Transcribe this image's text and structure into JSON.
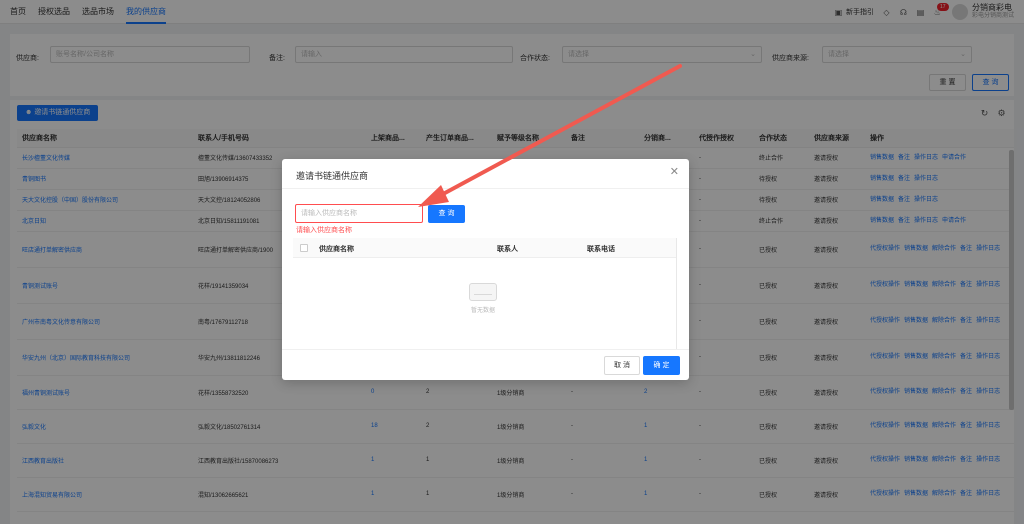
{
  "nav": {
    "tabs": [
      {
        "label": "首页"
      },
      {
        "label": "授权选品"
      },
      {
        "label": "选品市场"
      },
      {
        "label": "我的供应商",
        "active": true
      }
    ],
    "guide_label": "新手指引",
    "notification_count": "17",
    "user_name": "分销商彩电",
    "user_sub": "彩电分销商测试"
  },
  "filter": {
    "supplier_label": "供应商:",
    "supplier_placeholder": "账号名称/公司名称",
    "remark_label": "备注:",
    "remark_placeholder": "请输入",
    "coop_label": "合作状态:",
    "coop_placeholder": "请选择",
    "source_label": "供应商来源:",
    "source_placeholder": "请选择",
    "reset_label": "重 置",
    "search_label": "查 询"
  },
  "toolbar": {
    "invite_label": "邀请书链通供应商"
  },
  "table": {
    "columns": [
      "供应商名称",
      "联系人/手机号码",
      "上架商品...",
      "产生订单商品...",
      "赋予等级名称",
      "备注",
      "分销商...",
      "代授作授权",
      "合作状态",
      "供应商来源",
      "操作"
    ],
    "rows": [
      {
        "name": "长沙檀董文化传媒",
        "contact": "檀董文化传媒/13607433352",
        "c3": "",
        "c4": "",
        "c5": "",
        "c6": "",
        "c7": "",
        "c8": "-",
        "status": "终止合作",
        "source": "邀请授权",
        "ops": [
          "销售数据",
          "备注",
          "操作日志",
          "申请合作"
        ]
      },
      {
        "name": "青铜图书",
        "contact": "田旭/13906914375",
        "c3": "",
        "c4": "",
        "c5": "",
        "c6": "",
        "c7": "",
        "c8": "-",
        "status": "待授权",
        "source": "邀请授权",
        "ops": [
          "销售数据",
          "备注",
          "操作日志"
        ]
      },
      {
        "name": "天大文化控股（中国）股份有限公司",
        "contact": "天大文控/18124052806",
        "c3": "",
        "c4": "",
        "c5": "",
        "c6": "",
        "c7": "",
        "c8": "-",
        "status": "待授权",
        "source": "邀请授权",
        "ops": [
          "销售数据",
          "备注",
          "操作日志"
        ]
      },
      {
        "name": "北京日知",
        "contact": "北京日知/15811191081",
        "c3": "",
        "c4": "",
        "c5": "",
        "c6": "",
        "c7": "",
        "c8": "-",
        "status": "终止合作",
        "source": "邀请授权",
        "ops": [
          "销售数据",
          "备注",
          "操作日志",
          "申请合作"
        ]
      },
      {
        "name": "旺店通打单解密供应商",
        "contact": "旺店通打单解密供应商/1900",
        "c3": "",
        "c4": "",
        "c5": "",
        "c6": "",
        "c7": "",
        "c8": "-",
        "status": "已授权",
        "source": "邀请授权",
        "ops": [
          "代授权操作",
          "销售数据",
          "解除合作",
          "备注",
          "操作日志"
        ]
      },
      {
        "name": "青铜测试账号",
        "contact": "花样/19141359034",
        "c3": "",
        "c4": "",
        "c5": "",
        "c6": "",
        "c7": "",
        "c8": "-",
        "status": "已授权",
        "source": "邀请授权",
        "ops": [
          "代授权操作",
          "销售数据",
          "解除合作",
          "备注",
          "操作日志"
        ]
      },
      {
        "name": "广州市南粤文化传意有限公司",
        "contact": "南粤/17679112718",
        "c3": "",
        "c4": "",
        "c5": "",
        "c6": "",
        "c7": "",
        "c8": "-",
        "status": "已授权",
        "source": "邀请授权",
        "ops": [
          "代授权操作",
          "销售数据",
          "解除合作",
          "备注",
          "操作日志"
        ]
      },
      {
        "name": "华安九州（北京）国际教育科技有限公司",
        "contact": "华安九州/13811812246",
        "c3": "",
        "c4": "",
        "c5": "",
        "c6": "",
        "c7": "",
        "c8": "-",
        "status": "已授权",
        "source": "邀请授权",
        "ops": [
          "代授权操作",
          "销售数据",
          "解除合作",
          "备注",
          "操作日志"
        ]
      },
      {
        "name": "福州青铜测试账号",
        "contact": "花样/13558732520",
        "c3": "0",
        "c4": "2",
        "c5": "1级分销商",
        "c6": "-",
        "c7": "2",
        "c8": "-",
        "status": "已授权",
        "source": "邀请授权",
        "ops": [
          "代授权操作",
          "销售数据",
          "解除合作",
          "备注",
          "操作日志"
        ]
      },
      {
        "name": "弘毅文化",
        "contact": "弘毅文化/18502761314",
        "c3": "18",
        "c4": "2",
        "c5": "1级分销商",
        "c6": "-",
        "c7": "1",
        "c8": "-",
        "status": "已授权",
        "source": "邀请授权",
        "ops": [
          "代授权操作",
          "销售数据",
          "解除合作",
          "备注",
          "操作日志"
        ]
      },
      {
        "name": "江西教育出版社",
        "contact": "江西教育出版社/15870086273",
        "c3": "1",
        "c4": "1",
        "c5": "1级分销商",
        "c6": "-",
        "c7": "1",
        "c8": "-",
        "status": "已授权",
        "source": "邀请授权",
        "ops": [
          "代授权操作",
          "销售数据",
          "解除合作",
          "备注",
          "操作日志"
        ]
      },
      {
        "name": "上海混知贸易有限公司",
        "contact": "混知/13062665621",
        "c3": "1",
        "c4": "1",
        "c5": "1级分销商",
        "c6": "-",
        "c7": "1",
        "c8": "-",
        "status": "已授权",
        "source": "邀请授权",
        "ops": [
          "代授权操作",
          "销售数据",
          "解除合作",
          "备注",
          "操作日志"
        ]
      }
    ]
  },
  "modal": {
    "title": "邀请书链通供应商",
    "search_placeholder": "请输入供应商名称",
    "error_text": "请输入供应商名称",
    "query_label": "查 询",
    "col_name": "供应商名称",
    "col_contact": "联系人",
    "col_phone": "联系电话",
    "empty_text": "暂无数据",
    "cancel_label": "取 消",
    "ok_label": "确 定"
  },
  "colors": {
    "primary": "#1677ff",
    "error": "#ff4d4f",
    "arrow": "#f05a50"
  }
}
